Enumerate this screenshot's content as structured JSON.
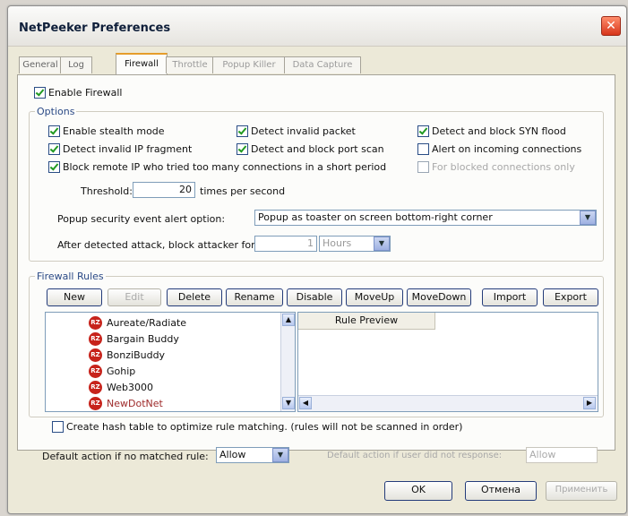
{
  "window": {
    "title": "NetPeeker Preferences",
    "close_glyph": "✕"
  },
  "tabs": [
    "General",
    "Log",
    "Firewall",
    "Throttle",
    "Popup Killer",
    "Data Capture"
  ],
  "active_tab": "Firewall",
  "enable_firewall": {
    "label": "Enable Firewall",
    "checked": true
  },
  "options": {
    "legend": "Options",
    "stealth": {
      "label": "Enable stealth mode",
      "checked": true
    },
    "invalid_packet": {
      "label": "Detect invalid packet",
      "checked": true
    },
    "syn_flood": {
      "label": "Detect and block SYN flood",
      "checked": true
    },
    "invalid_ip_fragment": {
      "label": "Detect invalid IP fragment",
      "checked": true
    },
    "port_scan": {
      "label": "Detect and block port scan",
      "checked": true
    },
    "alert_incoming": {
      "label": "Alert on incoming connections",
      "checked": false
    },
    "block_remote_ip": {
      "label": "Block remote IP who tried too many connections in a short period",
      "checked": true
    },
    "blocked_only": {
      "label": "For blocked connections only",
      "checked": false
    },
    "threshold_label": "Threshold:",
    "threshold_value": "20",
    "threshold_unit": "times per second",
    "popup_label": "Popup security event alert option:",
    "popup_value": "Popup as toaster on screen bottom-right corner",
    "block_attacker_label": "After detected attack, block attacker for",
    "block_attacker_value": "1",
    "block_attacker_unit": "Hours"
  },
  "rules": {
    "legend": "Firewall Rules",
    "buttons": [
      "New",
      "Edit",
      "Delete",
      "Rename",
      "Disable",
      "MoveUp",
      "MoveDown",
      "Import",
      "Export"
    ],
    "items": [
      "Aureate/Radiate",
      "Bargain Buddy",
      "BonziBuddy",
      "Gohip",
      "Web3000",
      "NewDotNet"
    ],
    "preview_header": "Rule Preview",
    "hash_table": {
      "label": "Create hash table to optimize rule matching. (rules will not be scanned in order)",
      "checked": false
    },
    "default_action_label": "Default action if no matched rule:",
    "default_action_value": "Allow",
    "user_no_response_label": "Default action if user did not response:",
    "user_no_response_value": "Allow"
  },
  "footer": {
    "ok": "OK",
    "cancel": "Отмена",
    "apply": "Применить"
  }
}
